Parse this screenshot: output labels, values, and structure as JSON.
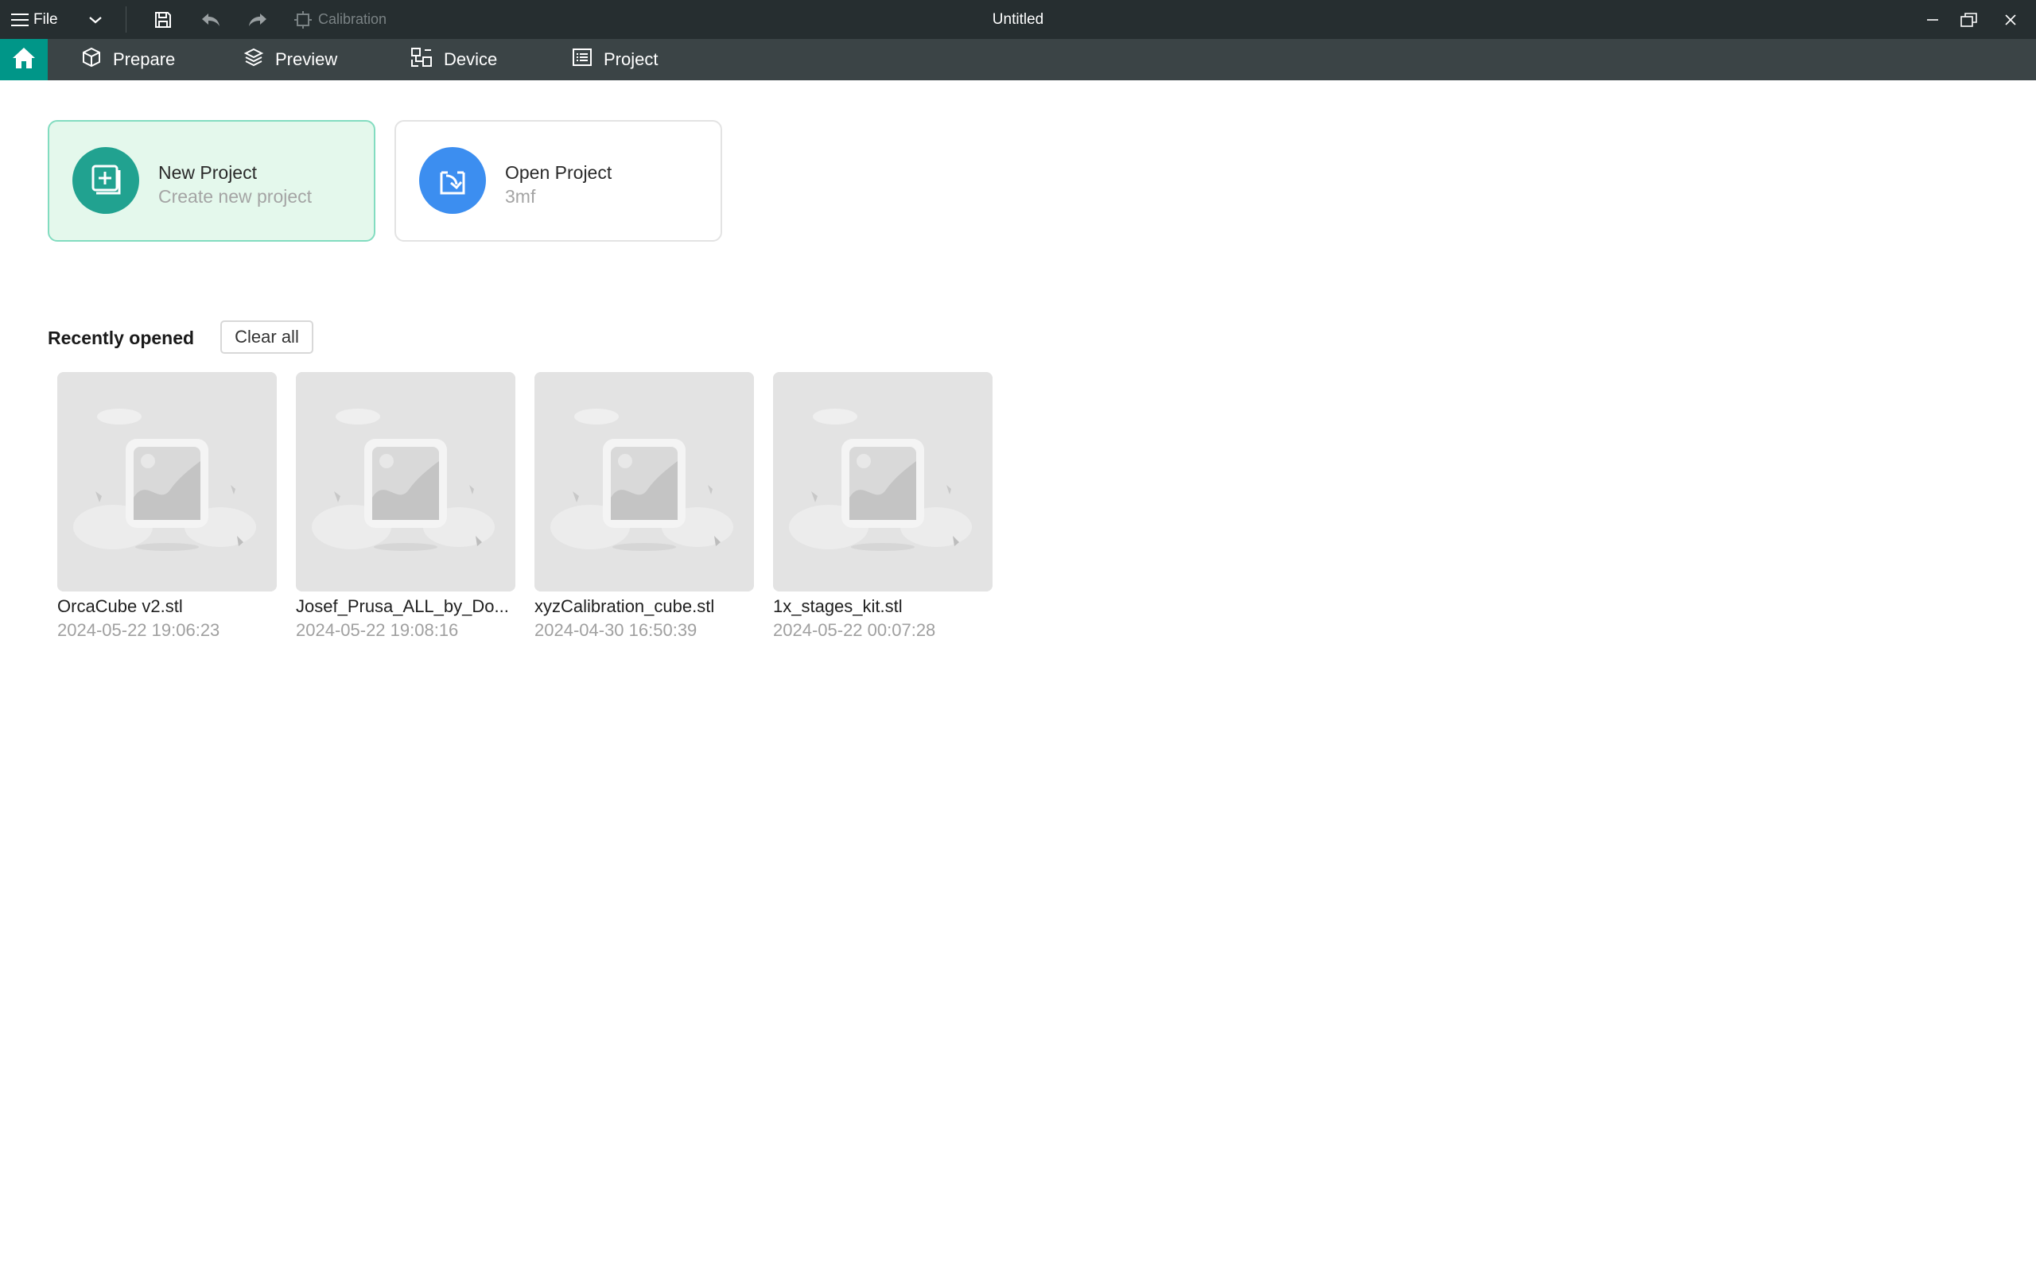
{
  "titlebar": {
    "file_label": "File",
    "calibration_label": "Calibration",
    "window_title": "Untitled"
  },
  "tabs": {
    "home_icon": "home-icon",
    "prepare": "Prepare",
    "preview": "Preview",
    "device": "Device",
    "project": "Project"
  },
  "cards": {
    "new_project": {
      "title": "New Project",
      "subtitle": "Create new project",
      "icon": "new-project-icon",
      "color": "#21a290"
    },
    "open_project": {
      "title": "Open Project",
      "subtitle": "3mf",
      "icon": "open-project-icon",
      "color": "#3c8ef0"
    }
  },
  "recent": {
    "label": "Recently opened",
    "clear_label": "Clear all",
    "items": [
      {
        "name": "OrcaCube v2.stl",
        "date": "2024-05-22 19:06:23"
      },
      {
        "name": "Josef_Prusa_ALL_by_Do...",
        "date": "2024-05-22 19:08:16"
      },
      {
        "name": "xyzCalibration_cube.stl",
        "date": "2024-04-30 16:50:39"
      },
      {
        "name": "1x_stages_kit.stl",
        "date": "2024-05-22 00:07:28"
      }
    ]
  },
  "colors": {
    "titlebar_bg": "#262e30",
    "tabbar_bg": "#3b4446",
    "accent": "#009688"
  }
}
